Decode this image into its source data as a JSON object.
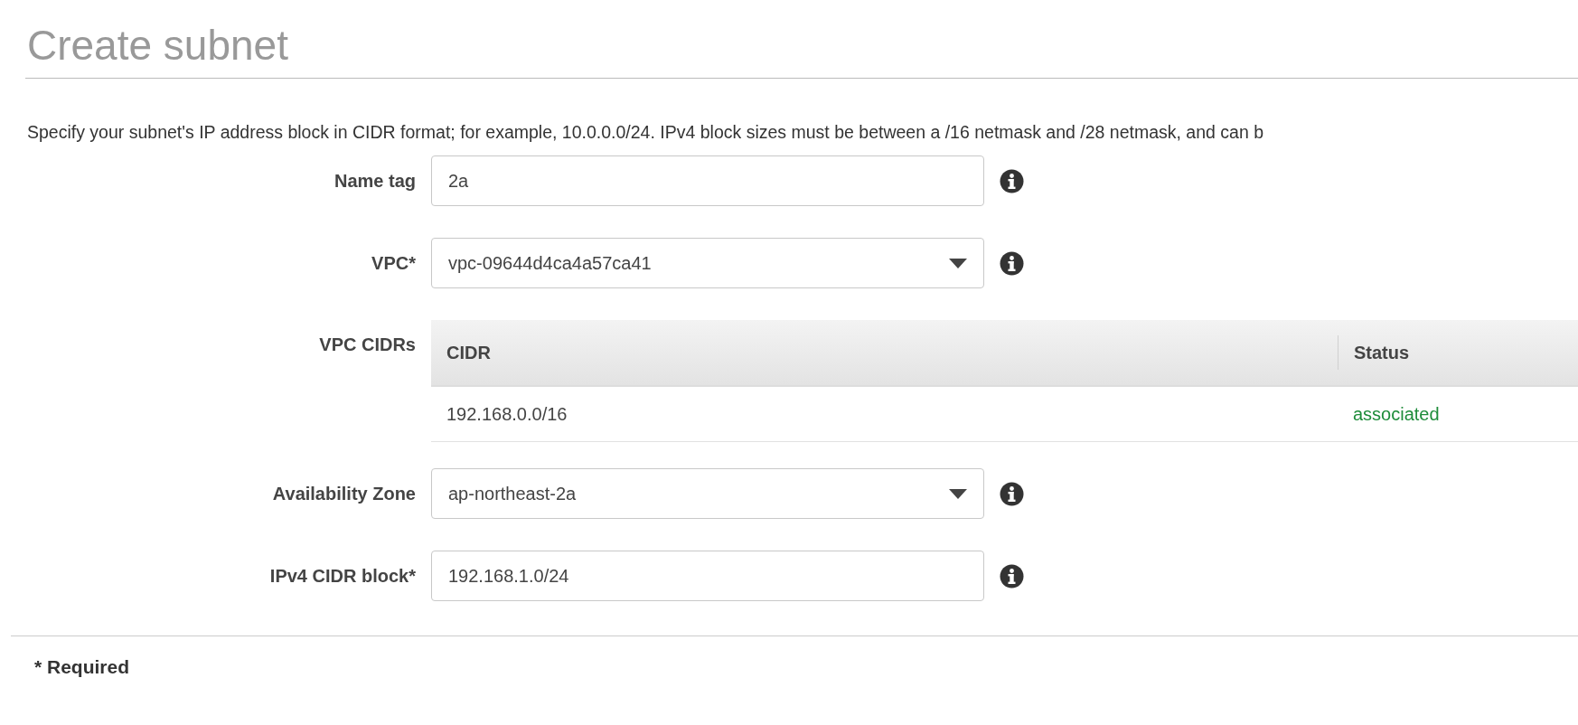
{
  "page_title": "Create subnet",
  "description": "Specify your subnet's IP address block in CIDR format; for example, 10.0.0.0/24. IPv4 block sizes must be between a /16 netmask and /28 netmask, and can b",
  "fields": [
    {
      "label": "Name tag",
      "kind": "text",
      "value": "2a"
    },
    {
      "label": "VPC*",
      "kind": "select",
      "value": "vpc-09644d4ca4a57ca41"
    },
    {
      "label": "VPC CIDRs",
      "kind": "table",
      "columns": [
        "CIDR",
        "Status"
      ],
      "rows": [
        [
          "192.168.0.0/16",
          "associated"
        ]
      ]
    },
    {
      "label": "Availability Zone",
      "kind": "select",
      "value": "ap-northeast-2a"
    },
    {
      "label": "IPv4 CIDR block*",
      "kind": "text",
      "value": "192.168.1.0/24"
    }
  ],
  "footer_note": "* Required"
}
